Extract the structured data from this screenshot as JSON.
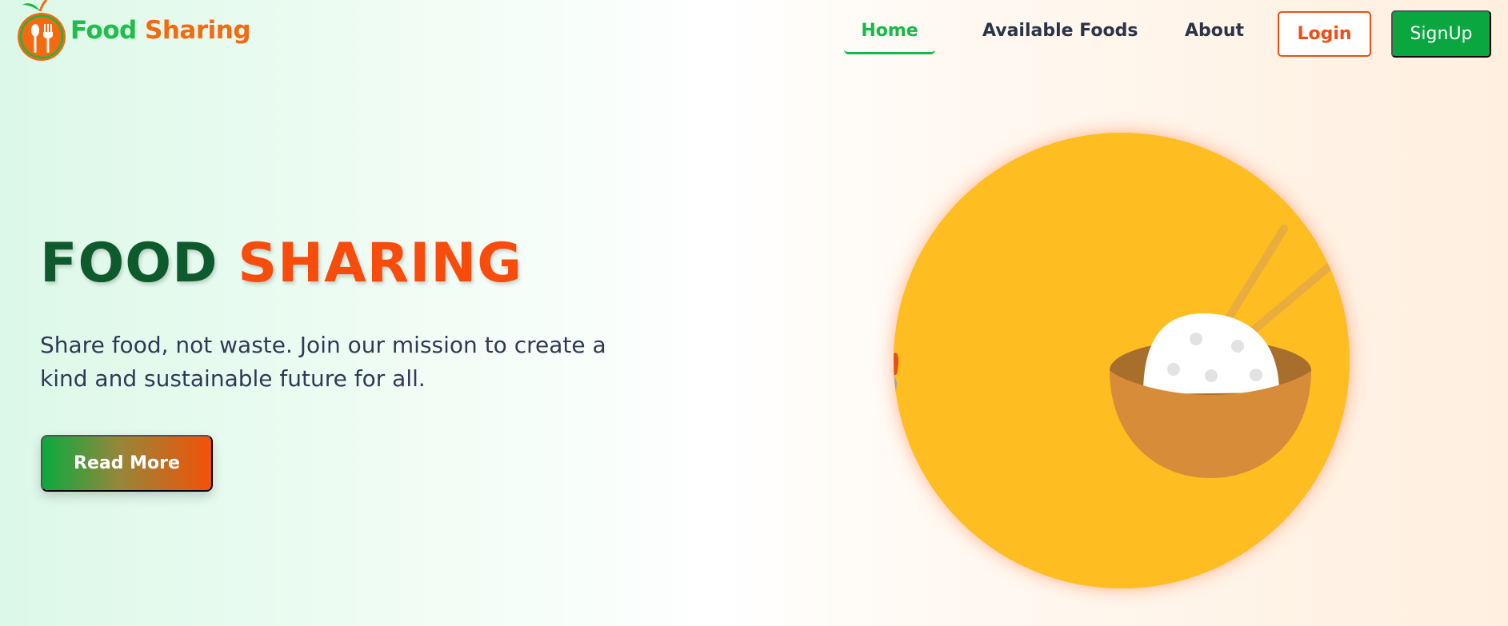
{
  "brand": {
    "name_part1": "Food",
    "name_part2": "Sharing",
    "logo_icon": "apple-fork-spoon-logo",
    "colors": {
      "green": "#1fbe4a",
      "orange": "#f36a10"
    }
  },
  "nav": {
    "items": [
      {
        "label": "Home",
        "active": true
      },
      {
        "label": "Available Foods",
        "active": false
      },
      {
        "label": "About",
        "active": false
      }
    ],
    "login_label": "Login",
    "signup_label": "SignUp"
  },
  "hero": {
    "title_part1": "FOOD",
    "title_part2": "SHARING",
    "subtitle": "Share food, not waste. Join our mission to create a kind and sustainable future for all.",
    "cta_label": "Read More",
    "illustration": "rice-bowl-with-chopsticks-illustration"
  },
  "colors": {
    "accent_green": "#0aa63f",
    "accent_orange": "#ef4e11",
    "dark_green": "#0d5a2c",
    "illustration_bg": "#febd20"
  }
}
